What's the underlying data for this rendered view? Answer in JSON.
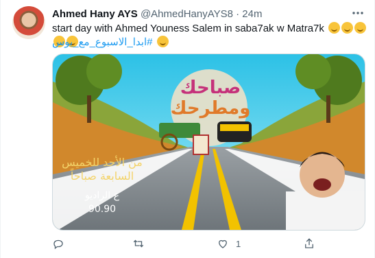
{
  "tweet": {
    "author_name": "Ahmed Hany AYS",
    "handle": "@AhmedHanyAYS8",
    "separator": "·",
    "time": "24m",
    "text": "start day with Ahmed Youness Salem in saba7ak w Matra7k",
    "hashtag": "#ابدا_الاسبوع_مع_يوس",
    "emoji_count": 5
  },
  "media": {
    "logo_line1": "صباحك",
    "logo_line2": "ومطرحك",
    "schedule_line1": "من الأحد للخميس",
    "schedule_line2": "السابعة صباحاً",
    "radio_label": "ع الراديو",
    "frequency": "90.90"
  },
  "actions": {
    "reply_icon": "reply-icon",
    "retweet_icon": "retweet-icon",
    "like_icon": "heart-icon",
    "like_count": "1",
    "share_icon": "share-icon"
  },
  "colors": {
    "hashtag": "#1d9bf0",
    "muted": "#536471",
    "text": "#0f1419"
  }
}
